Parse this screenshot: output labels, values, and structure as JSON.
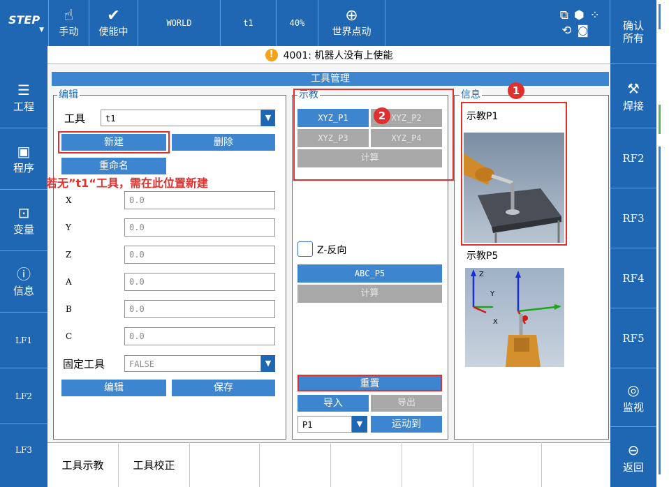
{
  "colors": {
    "primary": "#1f66b3",
    "button": "#3d86cf",
    "disabled": "#a8a8a8",
    "annotation": "#e0302e",
    "warning": "#f2a21b"
  },
  "topbar": {
    "step": "STEP",
    "mode_label": "手动",
    "enable_label": "使能中",
    "coord": "WORLD",
    "tool": "t1",
    "speed": "40%",
    "jog_label": "世界点动",
    "confirm_all": "确认所有"
  },
  "alarm": {
    "text": "4001: 机器人没有上使能"
  },
  "leftnav": [
    {
      "label": "工程",
      "icon": "project-icon"
    },
    {
      "label": "程序",
      "icon": "program-icon"
    },
    {
      "label": "变量",
      "icon": "variable-icon"
    },
    {
      "label": "信息",
      "icon": "info-icon"
    },
    {
      "label": "LF1"
    },
    {
      "label": "LF2"
    },
    {
      "label": "LF3"
    }
  ],
  "rightnav": [
    {
      "label": "焊接",
      "icon": "weld-icon"
    },
    {
      "label": "RF2"
    },
    {
      "label": "RF3"
    },
    {
      "label": "RF4"
    },
    {
      "label": "RF5"
    },
    {
      "label": "监视",
      "icon": "monitor-icon"
    },
    {
      "label": "返回",
      "icon": "back-icon"
    }
  ],
  "panel": {
    "title": "工具管理"
  },
  "edit": {
    "legend": "编辑",
    "tool_label": "工具",
    "tool_value": "t1",
    "new_btn": "新建",
    "delete_btn": "删除",
    "rename_btn": "重命名",
    "annotation": "若无”t1“工具，需在此位置新建",
    "fields": [
      {
        "label": "X",
        "value": "0.0"
      },
      {
        "label": "Y",
        "value": "0.0"
      },
      {
        "label": "Z",
        "value": "0.0"
      },
      {
        "label": "A",
        "value": "0.0"
      },
      {
        "label": "B",
        "value": "0.0"
      },
      {
        "label": "C",
        "value": "0.0"
      }
    ],
    "fixed_label": "固定工具",
    "fixed_value": "FALSE",
    "edit_btn": "编辑",
    "save_btn": "保存"
  },
  "teach": {
    "legend": "示教",
    "p1": "XYZ_P1",
    "p2": "XYZ_P2",
    "p3": "XYZ_P3",
    "p4": "XYZ_P4",
    "calc": "计算",
    "z_reverse": "Z-反向",
    "abc_p5": "ABC_P5",
    "calc2": "计算",
    "reset": "重置",
    "import": "导入",
    "export": "导出",
    "point": "P1",
    "move_to": "运动到"
  },
  "info": {
    "legend": "信息",
    "p1_title": "示教P1",
    "p5_title": "示教P5",
    "axis_z": "Z",
    "axis_y": "Y",
    "axis_x": "X"
  },
  "badges": {
    "one": "1",
    "two": "2"
  },
  "bottom_tabs": [
    "工具示教",
    "工具校正"
  ]
}
